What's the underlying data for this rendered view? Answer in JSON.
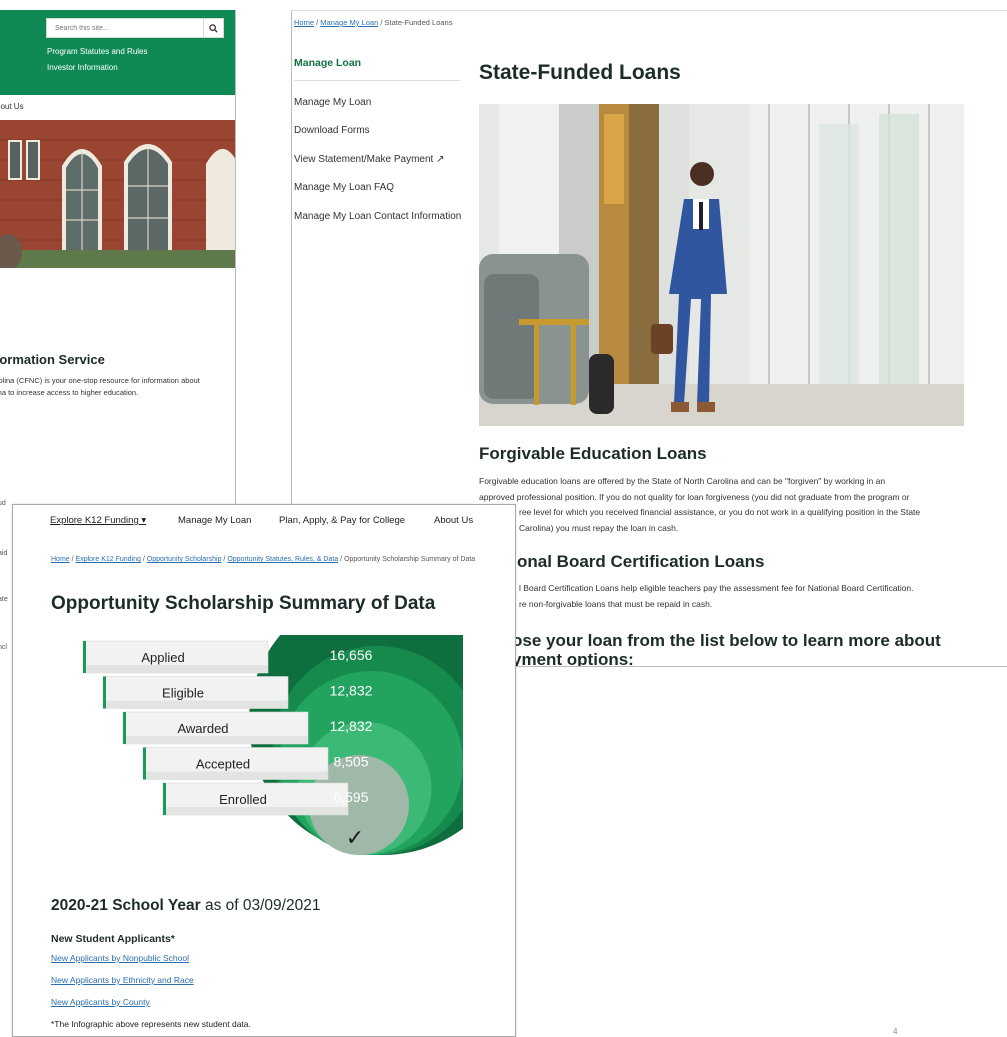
{
  "panel_a": {
    "search_placeholder": "Search this site...",
    "search_icon": "magnifier",
    "nav_links": [
      "Program Statutes and Rules",
      "Investor Information"
    ],
    "about_link": "bout Us",
    "section_title": "formation Service",
    "section_text_1": "rolina (CFNC) is your one-stop resource for information about",
    "section_text_2": "ina to increase access to higher education.",
    "fragments": [
      "ud",
      "aid",
      "ate",
      "ncl"
    ]
  },
  "panel_b": {
    "breadcrumb": {
      "home": "Home",
      "manage_my_loan": "Manage My Loan",
      "current": "State-Funded Loans"
    },
    "sidebar": {
      "title": "Manage Loan",
      "items": [
        "Manage My Loan",
        "Download Forms",
        "View Statement/Make Payment ↗",
        "Manage My Loan FAQ",
        "Manage My Loan Contact Information"
      ]
    },
    "page_title": "State-Funded Loans",
    "section1": {
      "title": "Forgivable Education Loans",
      "line1": "Forgivable education loans are offered by the State of North Carolina and can be \"forgiven\" by working in an",
      "line2": "approved professional position. If you do not quality for loan forgiveness (you did not graduate from the program or",
      "line3": "ree level for which you received financial assistance, or you do not work in a qualifying position in the State",
      "line4": "Carolina) you must repay the loan in cash."
    },
    "section2": {
      "title": "onal Board Certification Loans",
      "line1": "l Board Certification Loans help eligible teachers pay the assessment fee for National Board Certification.",
      "line2": "re non-forgivable loans that must be repaid in cash."
    },
    "section3": {
      "title_line1": "ose your loan from the list below to learn more about",
      "title_line2": "yment options:"
    }
  },
  "panel_c": {
    "nav": {
      "explore": "Explore K12 Funding",
      "manage": "Manage My Loan",
      "plan": "Plan, Apply, & Pay for College",
      "about": "About Us"
    },
    "breadcrumb": {
      "home": "Home",
      "explore": "Explore K12 Funding",
      "scholarship": "Opportunity Scholarship",
      "statutes": "Opportunity Statutes, Rules, & Data",
      "current": "Opportunity Scholarship Summary of Data"
    },
    "page_title": "Opportunity Scholarship Summary of Data",
    "school_year_bold": "2020-21 School Year",
    "school_year_rest": "as of 03/09/2021",
    "applicants_heading": "New Student Applicants*",
    "links": [
      "New Applicants by Nonpublic School",
      "New Applicants by Ethnicity and Race",
      "New Applicants by County"
    ],
    "footnote": "*The Infographic above represents new student data."
  },
  "chart_data": {
    "type": "bar",
    "categories": [
      "Applied",
      "Eligible",
      "Awarded",
      "Accepted",
      "Enrolled"
    ],
    "series": [
      {
        "values": [
          16656,
          12832,
          12832,
          8505,
          6595
        ]
      }
    ],
    "value_labels": [
      "16,656",
      "12,832",
      "12,832",
      "8,505",
      "6,595"
    ],
    "checkmark": "✓",
    "colors": [
      "#0f6e3e",
      "#168a4d",
      "#22a35e",
      "#3db977",
      "#9fb8a8"
    ]
  },
  "corner_mark": "4"
}
